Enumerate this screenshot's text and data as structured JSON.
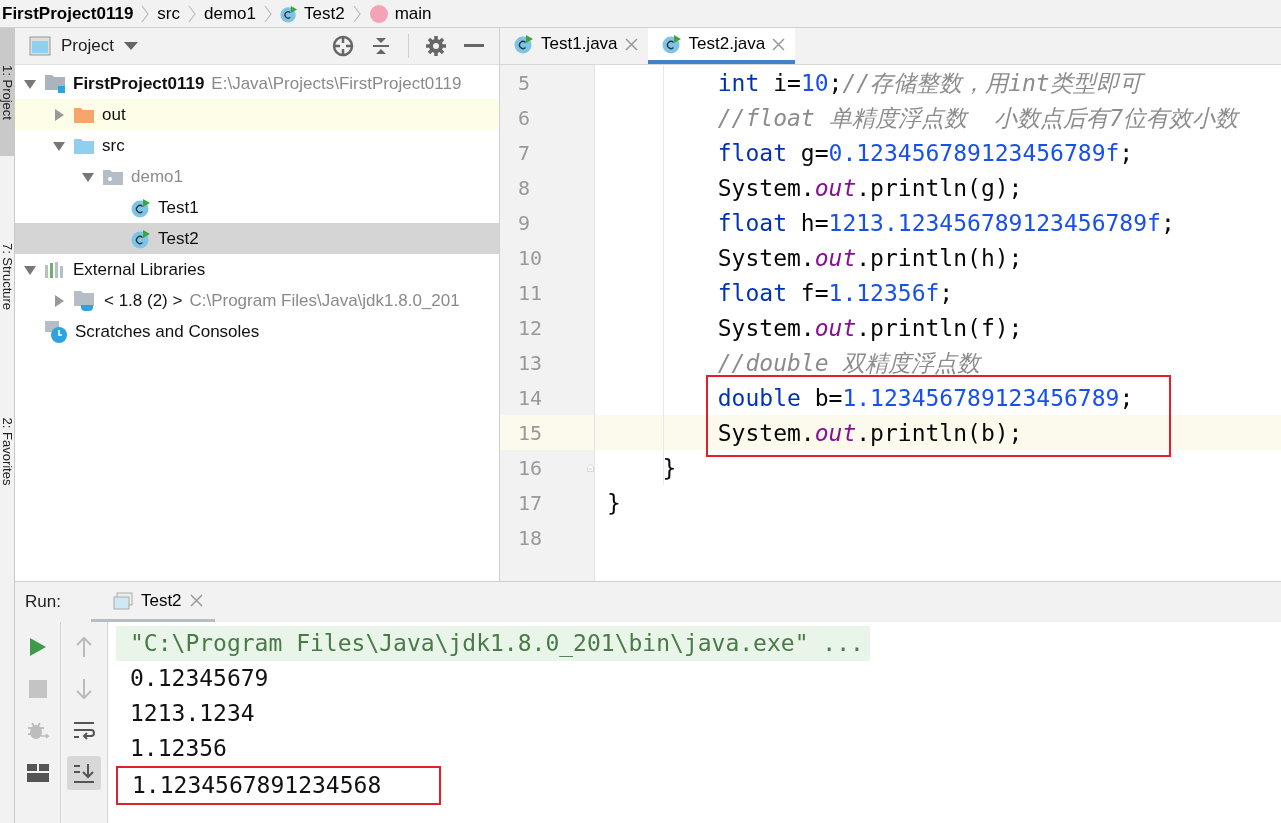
{
  "breadcrumbs": [
    {
      "label": "FirstProject0119",
      "kind": "project"
    },
    {
      "label": "src",
      "kind": "folder"
    },
    {
      "label": "demo1",
      "kind": "folder"
    },
    {
      "label": "Test2",
      "kind": "class"
    },
    {
      "label": "main",
      "kind": "method"
    }
  ],
  "left_stripe": [
    {
      "label": "1: Project",
      "selected": true
    },
    {
      "label": "7: Structure",
      "selected": false
    },
    {
      "label": "2: Favorites",
      "selected": false
    }
  ],
  "project_panel": {
    "title": "Project",
    "tree": [
      {
        "label": "FirstProject0119",
        "detail": "E:\\Java\\Projects\\FirstProject0119",
        "kind": "project",
        "expanded": true,
        "selected": false,
        "hovered": false,
        "children": [
          {
            "label": "out",
            "kind": "output-folder",
            "expanded": false,
            "selected": false,
            "hovered": true
          },
          {
            "label": "src",
            "kind": "source-folder",
            "expanded": true,
            "selected": false,
            "hovered": false,
            "children": [
              {
                "label": "demo1",
                "kind": "package",
                "expanded": true,
                "selected": false,
                "hovered": false,
                "children": [
                  {
                    "label": "Test1",
                    "kind": "class",
                    "selected": false,
                    "hovered": false
                  },
                  {
                    "label": "Test2",
                    "kind": "class",
                    "selected": true,
                    "hovered": false
                  }
                ]
              }
            ]
          }
        ]
      },
      {
        "label": "External Libraries",
        "kind": "libraries",
        "expanded": true,
        "selected": false,
        "hovered": false,
        "children": [
          {
            "label": "< 1.8 (2) >",
            "detail": "C:\\Program Files\\Java\\jdk1.8.0_201",
            "kind": "jdk",
            "expanded": false,
            "selected": false,
            "hovered": false
          }
        ]
      },
      {
        "label": "Scratches and Consoles",
        "kind": "scratches",
        "selected": false,
        "hovered": false
      }
    ]
  },
  "editor": {
    "tabs": [
      {
        "label": "Test1.java",
        "selected": false
      },
      {
        "label": "Test2.java",
        "selected": true
      }
    ],
    "lines": [
      {
        "number": "5",
        "current": false,
        "marked": false,
        "tokens": [
          {
            "kind": "keyword",
            "text": "        int"
          },
          {
            "kind": "plain",
            "text": " i="
          },
          {
            "kind": "number",
            "text": "10"
          },
          {
            "kind": "plain",
            "text": ";"
          },
          {
            "kind": "comment",
            "text": "//存储整数，用int类型即可"
          }
        ]
      },
      {
        "number": "6",
        "current": false,
        "marked": false,
        "tokens": [
          {
            "kind": "comment",
            "text": "        //float 单精度浮点数  小数点后有7位有效小数"
          }
        ]
      },
      {
        "number": "7",
        "current": false,
        "marked": false,
        "tokens": [
          {
            "kind": "keyword",
            "text": "        float"
          },
          {
            "kind": "plain",
            "text": " g="
          },
          {
            "kind": "number",
            "text": "0.123456789123456789f"
          },
          {
            "kind": "plain",
            "text": ";"
          }
        ]
      },
      {
        "number": "8",
        "current": false,
        "marked": false,
        "tokens": [
          {
            "kind": "plain",
            "text": "        System."
          },
          {
            "kind": "static",
            "text": "out"
          },
          {
            "kind": "plain",
            "text": ".println(g);"
          }
        ]
      },
      {
        "number": "9",
        "current": false,
        "marked": false,
        "tokens": [
          {
            "kind": "keyword",
            "text": "        float"
          },
          {
            "kind": "plain",
            "text": " h="
          },
          {
            "kind": "number",
            "text": "1213.123456789123456789f"
          },
          {
            "kind": "plain",
            "text": ";"
          }
        ]
      },
      {
        "number": "10",
        "current": false,
        "marked": false,
        "tokens": [
          {
            "kind": "plain",
            "text": "        System."
          },
          {
            "kind": "static",
            "text": "out"
          },
          {
            "kind": "plain",
            "text": ".println(h);"
          }
        ]
      },
      {
        "number": "11",
        "current": false,
        "marked": false,
        "tokens": [
          {
            "kind": "keyword",
            "text": "        float"
          },
          {
            "kind": "plain",
            "text": " f="
          },
          {
            "kind": "number",
            "text": "1.12356f"
          },
          {
            "kind": "plain",
            "text": ";"
          }
        ]
      },
      {
        "number": "12",
        "current": false,
        "marked": false,
        "tokens": [
          {
            "kind": "plain",
            "text": "        System."
          },
          {
            "kind": "static",
            "text": "out"
          },
          {
            "kind": "plain",
            "text": ".println(f);"
          }
        ]
      },
      {
        "number": "13",
        "current": false,
        "marked": false,
        "tokens": [
          {
            "kind": "comment",
            "text": "        //double 双精度浮点数"
          }
        ]
      },
      {
        "number": "14",
        "current": false,
        "marked": true,
        "tokens": [
          {
            "kind": "keyword",
            "text": "        double"
          },
          {
            "kind": "plain",
            "text": " b="
          },
          {
            "kind": "number",
            "text": "1.123456789123456789"
          },
          {
            "kind": "plain",
            "text": ";"
          }
        ]
      },
      {
        "number": "15",
        "current": true,
        "marked": true,
        "tokens": [
          {
            "kind": "plain",
            "text": "        System."
          },
          {
            "kind": "static",
            "text": "out"
          },
          {
            "kind": "plain",
            "text": ".println(b);"
          }
        ]
      },
      {
        "number": "16",
        "current": false,
        "marked": false,
        "fold": true,
        "tokens": [
          {
            "kind": "plain",
            "text": "    }"
          }
        ]
      },
      {
        "number": "17",
        "current": false,
        "marked": false,
        "tokens": [
          {
            "kind": "plain",
            "text": "}"
          }
        ]
      },
      {
        "number": "18",
        "current": false,
        "marked": false
      }
    ]
  },
  "run_panel": {
    "label": "Run:",
    "tabs": [
      {
        "label": "Test2",
        "selected": true
      }
    ],
    "output": [
      {
        "text": "\"C:\\Program Files\\Java\\jdk1.8.0_201\\bin\\java.exe\" ...",
        "kind": "command",
        "marked": false
      },
      {
        "text": "0.12345679",
        "kind": "output",
        "marked": false
      },
      {
        "text": "1213.1234",
        "kind": "output",
        "marked": false
      },
      {
        "text": "1.12356",
        "kind": "output",
        "marked": false
      },
      {
        "text": "1.1234567891234568",
        "kind": "output",
        "marked": true
      }
    ]
  }
}
